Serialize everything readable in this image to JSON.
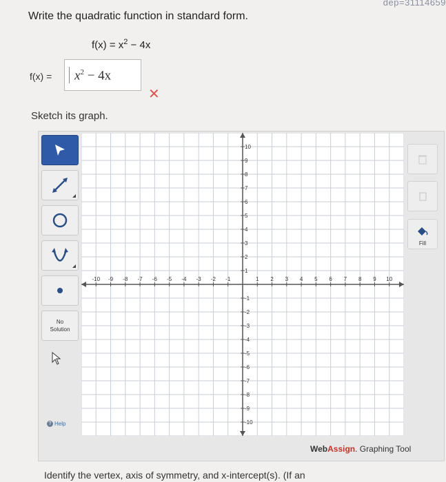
{
  "url_fragment": "dep=31114659",
  "question": {
    "prompt": "Write the quadratic function in standard form.",
    "given_lhs": "f(x) = x",
    "given_exp": "2",
    "given_rhs": " − 4x",
    "answer_label": "f(x) =",
    "answer_base": "x",
    "answer_exp": "2",
    "answer_rest": " − 4x",
    "status_icon": "incorrect-x-icon",
    "status_color": "#d9534f"
  },
  "sketch_label": "Sketch its graph.",
  "toolbar": {
    "tools": [
      {
        "name": "pointer-tool",
        "icon": "arrow-pointer-icon",
        "active": true
      },
      {
        "name": "line-tool",
        "icon": "line-segment-icon"
      },
      {
        "name": "circle-tool",
        "icon": "circle-icon"
      },
      {
        "name": "parabola-tool",
        "icon": "parabola-icon"
      },
      {
        "name": "point-tool",
        "icon": "point-icon"
      }
    ],
    "no_solution_line1": "No",
    "no_solution_line2": "Solution",
    "help_label": "Help",
    "active_color": "#2f5aa8"
  },
  "right_tools": {
    "fill_label": "Fill"
  },
  "graph": {
    "x_ticks": [
      "-10",
      "-9",
      "-8",
      "-7",
      "-6",
      "-5",
      "-4",
      "-3",
      "-2",
      "-1",
      "1",
      "2",
      "3",
      "4",
      "5",
      "6",
      "7",
      "8",
      "9",
      "10"
    ],
    "y_ticks": [
      "10",
      "9",
      "8",
      "7",
      "6",
      "5",
      "4",
      "3",
      "2",
      "1",
      "-1",
      "-2",
      "-3",
      "-4",
      "-5",
      "-6",
      "-7",
      "-8",
      "-9",
      "-10"
    ],
    "xlim": [
      -11,
      11
    ],
    "ylim": [
      -11,
      11
    ]
  },
  "brand": {
    "web": "Web",
    "assign": "Assign",
    "rest": ". Graphing Tool",
    "accent_color": "#c8312b"
  },
  "bottom_text": "Identify the vertex, axis of symmetry, and x-intercept(s). (If an"
}
